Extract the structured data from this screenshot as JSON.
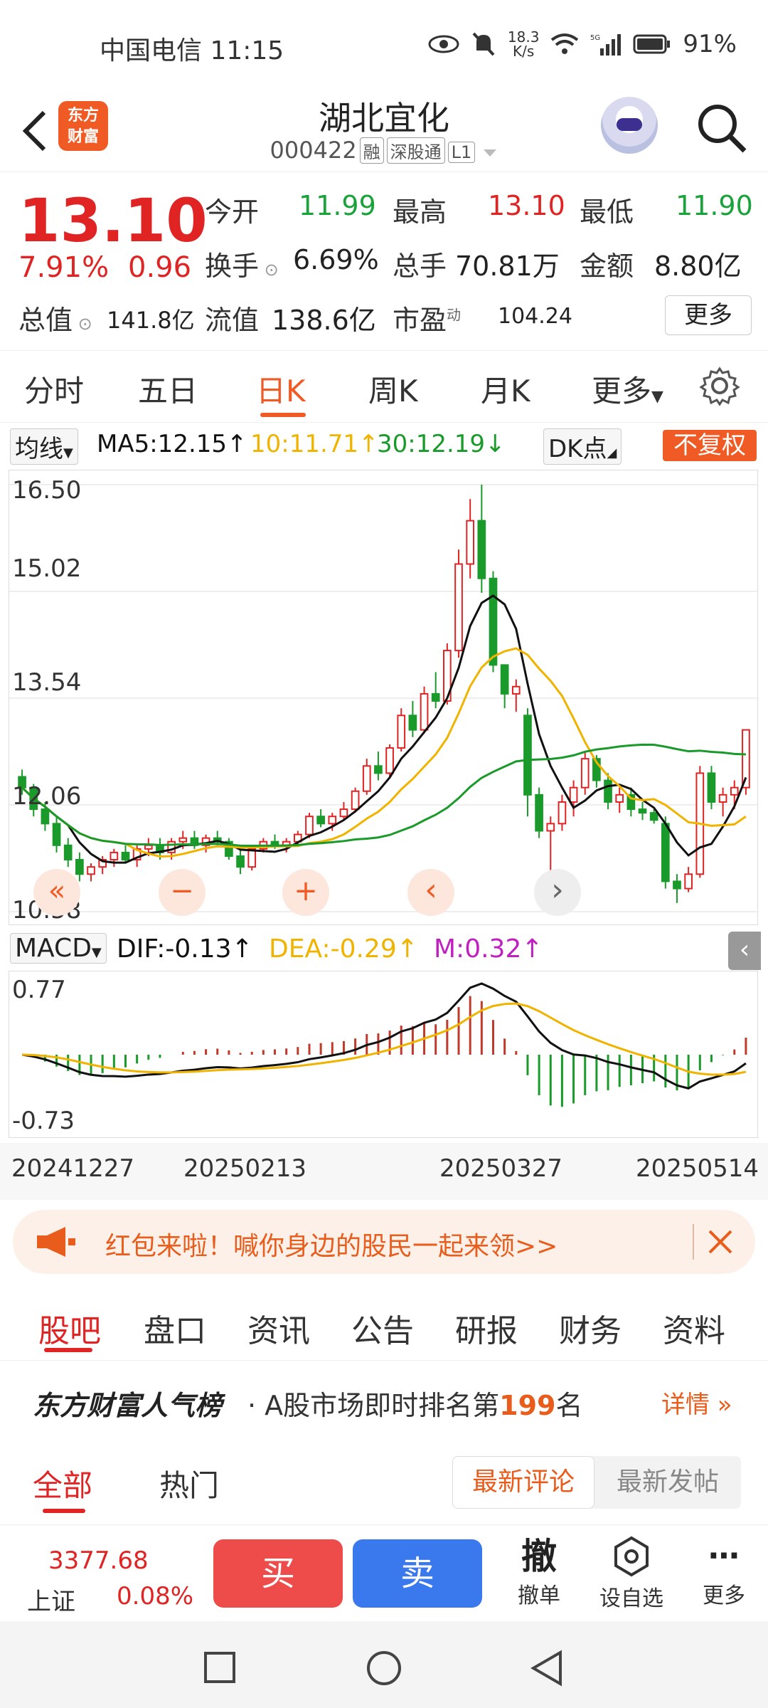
{
  "status_bar": {
    "carrier": "中国电信",
    "time": "11:15",
    "net_speed_top": "18.3",
    "net_speed_bottom": "K/s",
    "battery": "91%"
  },
  "header": {
    "logo_line1": "东方",
    "logo_line2": "财富",
    "title": "湖北宜化",
    "code": "000422",
    "tags": [
      "融",
      "深股通",
      "L1"
    ]
  },
  "quote": {
    "price": "13.10",
    "change_pct": "7.91%",
    "change_abs": "0.96",
    "open_label": "今开",
    "open_value": "11.99",
    "high_label": "最高",
    "high_value": "13.10",
    "low_label": "最低",
    "low_value": "11.90",
    "turnover_label": "换手",
    "turnover_value": "6.69%",
    "volume_label": "总手",
    "volume_value": "70.81万",
    "amount_label": "金额",
    "amount_value": "8.80亿",
    "mktcap_label": "总值",
    "mktcap_value": "141.8亿",
    "float_label": "流值",
    "float_value": "138.6亿",
    "pe_label": "市盈",
    "pe_sup": "动",
    "pe_value": "104.24",
    "more_label": "更多"
  },
  "k_tabs": [
    "分时",
    "五日",
    "日K",
    "周K",
    "月K",
    "更多"
  ],
  "k_tab_active": 2,
  "ma_bar": {
    "selector": "均线",
    "ma5": "MA5:12.15",
    "ma10": "10:11.71",
    "ma30": "30:12.19",
    "dk": "DK点",
    "adjust": "不复权",
    "colors": {
      "ma5": "#111111",
      "ma10": "#f0b400",
      "ma30": "#1a9a2a"
    }
  },
  "chart_data": {
    "type": "candlestick",
    "y_ticks": [
      "16.50",
      "15.02",
      "13.54",
      "12.06",
      "10.58"
    ],
    "ylim": [
      10.58,
      16.5
    ],
    "x_ticks": [
      "20241227",
      "20250213",
      "20250327",
      "20250514"
    ],
    "candles": [
      [
        12.45,
        12.55,
        12.2,
        12.3
      ],
      [
        12.3,
        12.35,
        11.9,
        12.0
      ],
      [
        12.0,
        12.1,
        11.7,
        11.8
      ],
      [
        11.8,
        11.9,
        11.4,
        11.5
      ],
      [
        11.5,
        11.6,
        11.2,
        11.3
      ],
      [
        11.3,
        11.4,
        11.0,
        11.1
      ],
      [
        11.1,
        11.25,
        11.0,
        11.2
      ],
      [
        11.2,
        11.35,
        11.1,
        11.3
      ],
      [
        11.3,
        11.45,
        11.2,
        11.4
      ],
      [
        11.4,
        11.5,
        11.25,
        11.3
      ],
      [
        11.3,
        11.5,
        11.2,
        11.45
      ],
      [
        11.45,
        11.6,
        11.35,
        11.5
      ],
      [
        11.5,
        11.6,
        11.3,
        11.4
      ],
      [
        11.4,
        11.6,
        11.3,
        11.55
      ],
      [
        11.55,
        11.7,
        11.45,
        11.6
      ],
      [
        11.6,
        11.7,
        11.45,
        11.5
      ],
      [
        11.5,
        11.65,
        11.4,
        11.6
      ],
      [
        11.6,
        11.7,
        11.5,
        11.55
      ],
      [
        11.55,
        11.6,
        11.3,
        11.35
      ],
      [
        11.35,
        11.45,
        11.1,
        11.2
      ],
      [
        11.2,
        11.5,
        11.15,
        11.45
      ],
      [
        11.45,
        11.6,
        11.4,
        11.55
      ],
      [
        11.55,
        11.65,
        11.45,
        11.5
      ],
      [
        11.5,
        11.6,
        11.4,
        11.55
      ],
      [
        11.55,
        11.7,
        11.5,
        11.65
      ],
      [
        11.65,
        11.95,
        11.6,
        11.9
      ],
      [
        11.9,
        12.0,
        11.75,
        11.8
      ],
      [
        11.8,
        11.95,
        11.7,
        11.9
      ],
      [
        11.9,
        12.1,
        11.85,
        12.0
      ],
      [
        12.0,
        12.3,
        11.95,
        12.25
      ],
      [
        12.25,
        12.7,
        12.2,
        12.6
      ],
      [
        12.6,
        12.8,
        12.4,
        12.5
      ],
      [
        12.5,
        12.9,
        12.45,
        12.85
      ],
      [
        12.85,
        13.4,
        12.8,
        13.3
      ],
      [
        13.3,
        13.5,
        13.0,
        13.1
      ],
      [
        13.1,
        13.7,
        13.05,
        13.6
      ],
      [
        13.6,
        13.9,
        13.4,
        13.5
      ],
      [
        13.5,
        14.3,
        13.45,
        14.2
      ],
      [
        14.2,
        15.6,
        14.1,
        15.4
      ],
      [
        15.4,
        16.3,
        15.2,
        16.0
      ],
      [
        16.0,
        16.5,
        15.0,
        15.2
      ],
      [
        15.2,
        15.3,
        13.9,
        14.0
      ],
      [
        14.0,
        13.9,
        13.4,
        13.6
      ],
      [
        13.6,
        13.8,
        13.35,
        13.7
      ],
      [
        13.3,
        13.4,
        11.9,
        12.2
      ],
      [
        12.2,
        12.3,
        11.6,
        11.7
      ],
      [
        11.7,
        11.9,
        10.6,
        11.8
      ],
      [
        11.8,
        12.2,
        11.7,
        12.1
      ],
      [
        12.1,
        12.4,
        11.9,
        12.3
      ],
      [
        12.3,
        12.8,
        12.2,
        12.7
      ],
      [
        12.7,
        12.75,
        12.3,
        12.4
      ],
      [
        12.4,
        12.5,
        12.0,
        12.1
      ],
      [
        12.1,
        12.3,
        11.95,
        12.2
      ],
      [
        12.2,
        12.3,
        11.9,
        12.0
      ],
      [
        12.0,
        12.1,
        11.85,
        11.95
      ],
      [
        11.95,
        12.0,
        11.8,
        11.85
      ],
      [
        11.8,
        11.9,
        10.9,
        11.0
      ],
      [
        11.0,
        11.1,
        10.7,
        10.9
      ],
      [
        10.9,
        11.2,
        10.85,
        11.1
      ],
      [
        11.1,
        12.6,
        11.05,
        12.5
      ],
      [
        12.5,
        12.6,
        12.0,
        12.1
      ],
      [
        12.1,
        12.3,
        11.9,
        12.2
      ],
      [
        12.2,
        12.4,
        12.0,
        12.3
      ],
      [
        12.3,
        13.1,
        12.2,
        13.1
      ]
    ],
    "ma_colors": [
      "#111111",
      "#f0b400",
      "#1a9a2a"
    ]
  },
  "macd_bar": {
    "selector": "MACD",
    "dif": "DIF:-0.13",
    "dea": "DEA:-0.29",
    "m": "M:0.32",
    "y_top": "0.77",
    "y_bottom": "-0.73",
    "colors": {
      "dif": "#111111",
      "dea": "#f0b400",
      "m": "#c020c0"
    }
  },
  "chart_controls": [
    "«",
    "−",
    "+",
    "‹",
    "›"
  ],
  "banner": {
    "text": "红包来啦！喊你身边的股民一起来领>>"
  },
  "content_tabs": [
    "股吧",
    "盘口",
    "资讯",
    "公告",
    "研报",
    "财务",
    "资料"
  ],
  "rank": {
    "brand": "东方财富人气榜",
    "text_pre": "· A股市场即时排名第",
    "rank_num": "199",
    "text_post": "名",
    "detail": "详情"
  },
  "sub_tabs": {
    "all": "全部",
    "hot": "热门",
    "latest_comment": "最新评论",
    "latest_post": "最新发帖"
  },
  "bottom_bar": {
    "index_value": "3377.68",
    "index_name": "上证",
    "index_pct": "0.08%",
    "buy": "买",
    "sell": "卖",
    "cancel_icon_char": "撤",
    "cancel_label": "撤单",
    "watch_label": "设自选",
    "more_label": "更多"
  }
}
